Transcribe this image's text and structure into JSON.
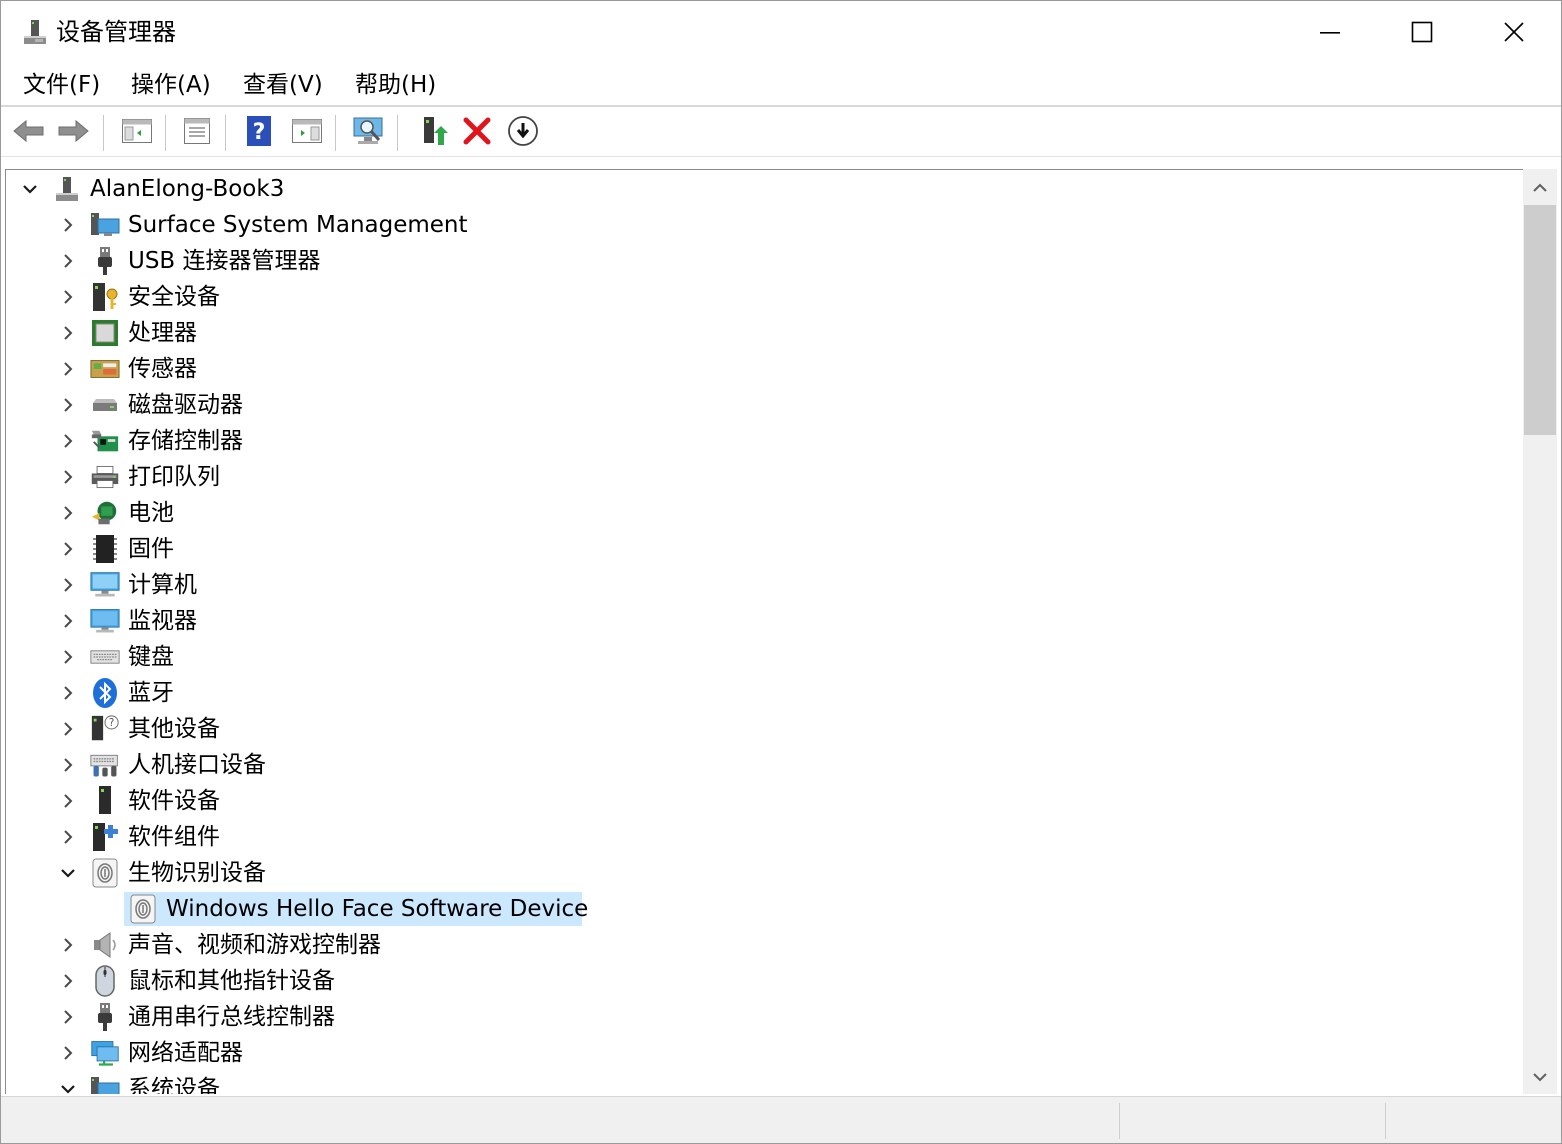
{
  "window": {
    "title": "设备管理器",
    "controls": {
      "minimize": "minimize",
      "maximize": "maximize",
      "close": "close"
    }
  },
  "menu": {
    "items": [
      "文件(F)",
      "操作(A)",
      "查看(V)",
      "帮助(H)"
    ]
  },
  "toolbar": {
    "buttons": [
      {
        "icon": "back-arrow-icon"
      },
      {
        "icon": "forward-arrow-icon"
      },
      {
        "icon": "show-hide-console-tree-icon"
      },
      {
        "icon": "properties-icon"
      },
      {
        "icon": "help-icon"
      },
      {
        "icon": "action-pane-icon"
      },
      {
        "icon": "scan-hardware-icon"
      },
      {
        "icon": "update-driver-icon"
      },
      {
        "icon": "uninstall-device-icon"
      },
      {
        "icon": "disable-device-icon"
      }
    ]
  },
  "tree": {
    "root": {
      "label": "AlanElong-Book3",
      "expanded": true
    },
    "categories": [
      {
        "label": "Surface System Management",
        "icon": "system-management-icon",
        "expanded": false
      },
      {
        "label": "USB 连接器管理器",
        "icon": "usb-connector-icon",
        "expanded": false
      },
      {
        "label": "安全设备",
        "icon": "security-device-icon",
        "expanded": false
      },
      {
        "label": "处理器",
        "icon": "processor-icon",
        "expanded": false
      },
      {
        "label": "传感器",
        "icon": "sensor-icon",
        "expanded": false
      },
      {
        "label": "磁盘驱动器",
        "icon": "disk-drive-icon",
        "expanded": false
      },
      {
        "label": "存储控制器",
        "icon": "storage-controller-icon",
        "expanded": false
      },
      {
        "label": "打印队列",
        "icon": "printer-icon",
        "expanded": false
      },
      {
        "label": "电池",
        "icon": "battery-icon",
        "expanded": false
      },
      {
        "label": "固件",
        "icon": "firmware-icon",
        "expanded": false
      },
      {
        "label": "计算机",
        "icon": "computer-icon",
        "expanded": false
      },
      {
        "label": "监视器",
        "icon": "monitor-icon",
        "expanded": false
      },
      {
        "label": "键盘",
        "icon": "keyboard-icon",
        "expanded": false
      },
      {
        "label": "蓝牙",
        "icon": "bluetooth-icon",
        "expanded": false
      },
      {
        "label": "其他设备",
        "icon": "other-device-icon",
        "expanded": false
      },
      {
        "label": "人机接口设备",
        "icon": "hid-icon",
        "expanded": false
      },
      {
        "label": "软件设备",
        "icon": "software-device-icon",
        "expanded": false
      },
      {
        "label": "软件组件",
        "icon": "software-component-icon",
        "expanded": false
      },
      {
        "label": "生物识别设备",
        "icon": "biometric-icon",
        "expanded": true,
        "children": [
          {
            "label": "Windows Hello Face Software Device",
            "icon": "fingerprint-icon",
            "selected": true
          }
        ]
      },
      {
        "label": "声音、视频和游戏控制器",
        "icon": "speaker-icon",
        "expanded": false
      },
      {
        "label": "鼠标和其他指针设备",
        "icon": "mouse-icon",
        "expanded": false
      },
      {
        "label": "通用串行总线控制器",
        "icon": "usb-controller-icon",
        "expanded": false
      },
      {
        "label": "网络适配器",
        "icon": "network-adapter-icon",
        "expanded": false
      },
      {
        "label": "系统设备",
        "icon": "system-device-icon",
        "expanded": true
      }
    ]
  },
  "colors": {
    "selection": "#cce8ff",
    "accent_blue": "#1e6fd9",
    "delete_red": "#e3131b"
  }
}
